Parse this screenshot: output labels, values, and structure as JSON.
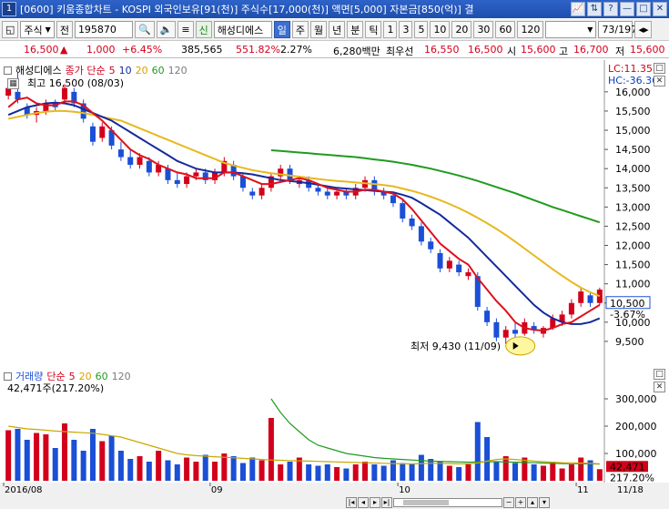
{
  "window": {
    "number": "1",
    "title": "[0600] 키움종합차트 - KOSPI 외국인보유[91(천)] 주식수[17,000(천)] 액면[5,000] 자본금[850(억)] 결",
    "buttons": [
      "📈",
      "⇅",
      "?",
      "—",
      "□",
      "✕"
    ]
  },
  "toolbar": {
    "market": "주식",
    "prev": "전",
    "code": "195870",
    "stock_name": "해성디에스",
    "periods": [
      "일",
      "주",
      "월",
      "년",
      "분",
      "틱"
    ],
    "intervals": [
      "1",
      "3",
      "5",
      "10",
      "20",
      "30",
      "60",
      "120"
    ],
    "paging": "73/197"
  },
  "quote": {
    "price": "16,500",
    "arrow": "▲",
    "change": "1,000",
    "change_pct": "+6.45%",
    "volume": "385,565",
    "vol_ratio": "551.82%",
    "turnover": "2.27%",
    "amount": "6,280백만",
    "best_ask_label": "최우선",
    "best_ask": "16,550",
    "best_bid": "16,500",
    "open_label": "시",
    "open": "15,600",
    "high_label": "고",
    "high": "16,700",
    "low_label": "저",
    "low": "15,600"
  },
  "price_panel": {
    "legend_name": "해성디에스",
    "legend_ma_label": "종가 단순",
    "legend_ma_periods": [
      "5",
      "10",
      "20",
      "60",
      "120"
    ],
    "high_note": "최고 16,500 (08/03)",
    "low_note": "최저 9,430 (11/09)",
    "lc": "LC:11.35",
    "hc": "HC:-36.36",
    "current_price_tag": "10,500",
    "current_pct_tag": "-3.67%"
  },
  "volume_panel": {
    "legend_name": "거래량",
    "legend_ma_label": "단순",
    "legend_ma_periods": [
      "5",
      "20",
      "60",
      "120"
    ],
    "current": "42,471주(217.20%)",
    "current_tag": "42,471",
    "current_pct_tag": "217.20%"
  },
  "colors": {
    "up": "#d2001b",
    "down": "#1a4fd6",
    "ma5": "#e0101c",
    "ma10": "#142a9a",
    "ma20": "#e8b820",
    "ma60": "#1f9b1f",
    "ma120": "#8a8a8a"
  },
  "chart_data": [
    {
      "type": "candlestick",
      "title": "해성디에스",
      "x_ticks": [
        "2016/08",
        "09",
        "10",
        "11",
        "11/18"
      ],
      "ylim": [
        9000,
        16400
      ],
      "yticks": [
        9500,
        10000,
        10500,
        11000,
        11500,
        12000,
        12500,
        13000,
        13500,
        14000,
        14500,
        15000,
        15500,
        16000
      ],
      "series": [
        {
          "name": "ohlc",
          "values": [
            [
              15900,
              16300,
              15800,
              16100
            ],
            [
              16000,
              16500,
              15700,
              15800
            ],
            [
              15600,
              15700,
              15300,
              15400
            ],
            [
              15400,
              15600,
              15200,
              15500
            ],
            [
              15500,
              15800,
              15400,
              15700
            ],
            [
              15700,
              15800,
              15500,
              15600
            ],
            [
              15800,
              16200,
              15700,
              16100
            ],
            [
              16000,
              16100,
              15600,
              15700
            ],
            [
              15700,
              15800,
              15200,
              15300
            ],
            [
              15100,
              15200,
              14600,
              14700
            ],
            [
              14800,
              15200,
              14700,
              15100
            ],
            [
              15000,
              15100,
              14500,
              14600
            ],
            [
              14500,
              14700,
              14200,
              14300
            ],
            [
              14300,
              14500,
              14000,
              14100
            ],
            [
              14100,
              14400,
              14000,
              14300
            ],
            [
              14200,
              14300,
              13800,
              13900
            ],
            [
              13900,
              14200,
              13800,
              14100
            ],
            [
              14000,
              14100,
              13600,
              13700
            ],
            [
              13700,
              13900,
              13500,
              13600
            ],
            [
              13600,
              13900,
              13500,
              13800
            ],
            [
              13800,
              14000,
              13700,
              13900
            ],
            [
              13900,
              14000,
              13600,
              13700
            ],
            [
              13700,
              14000,
              13600,
              13900
            ],
            [
              13900,
              14300,
              13800,
              14200
            ],
            [
              14100,
              14200,
              13700,
              13800
            ],
            [
              13800,
              13900,
              13400,
              13500
            ],
            [
              13400,
              13500,
              13200,
              13300
            ],
            [
              13300,
              13600,
              13200,
              13500
            ],
            [
              13500,
              13900,
              13400,
              13800
            ],
            [
              13800,
              14100,
              13700,
              14000
            ],
            [
              14000,
              14100,
              13600,
              13700
            ],
            [
              13600,
              13800,
              13500,
              13700
            ],
            [
              13700,
              13800,
              13400,
              13500
            ],
            [
              13500,
              13600,
              13300,
              13400
            ],
            [
              13400,
              13500,
              13200,
              13300
            ],
            [
              13300,
              13500,
              13200,
              13400
            ],
            [
              13400,
              13500,
              13200,
              13300
            ],
            [
              13300,
              13600,
              13200,
              13500
            ],
            [
              13500,
              13800,
              13400,
              13700
            ],
            [
              13700,
              13800,
              13300,
              13400
            ],
            [
              13400,
              13500,
              13200,
              13300
            ],
            [
              13300,
              13400,
              13000,
              13100
            ],
            [
              13100,
              13200,
              12600,
              12700
            ],
            [
              12700,
              12800,
              12400,
              12500
            ],
            [
              12500,
              12600,
              12000,
              12100
            ],
            [
              12100,
              12200,
              11800,
              11900
            ],
            [
              11800,
              11900,
              11300,
              11400
            ],
            [
              11400,
              11700,
              11300,
              11600
            ],
            [
              11500,
              11600,
              11200,
              11300
            ],
            [
              11200,
              11400,
              11100,
              11300
            ],
            [
              11200,
              11300,
              10300,
              10400
            ],
            [
              10300,
              10400,
              9900,
              10000
            ],
            [
              10000,
              10100,
              9500,
              9600
            ],
            [
              9600,
              9900,
              9430,
              9800
            ],
            [
              9800,
              10000,
              9600,
              9700
            ],
            [
              9700,
              10100,
              9650,
              10000
            ],
            [
              9900,
              10000,
              9700,
              9800
            ],
            [
              9700,
              9900,
              9600,
              9850
            ],
            [
              9850,
              10200,
              9800,
              10100
            ],
            [
              10000,
              10300,
              9900,
              10200
            ],
            [
              10200,
              10600,
              10100,
              10500
            ],
            [
              10500,
              10900,
              10400,
              10800
            ],
            [
              10700,
              10800,
              10400,
              10500
            ],
            [
              10500,
              10900,
              10450,
              10850
            ]
          ]
        },
        {
          "name": "5",
          "values": [
            15600,
            15800,
            15850,
            15700,
            15650,
            15650,
            15750,
            15750,
            15650,
            15450,
            15250,
            15000,
            14750,
            14500,
            14350,
            14250,
            14100,
            14000,
            13900,
            13850,
            13750,
            13750,
            13750,
            13900,
            13900,
            13800,
            13700,
            13600,
            13600,
            13650,
            13700,
            13750,
            13700,
            13600,
            13500,
            13450,
            13400,
            13400,
            13450,
            13450,
            13400,
            13350,
            13200,
            12950,
            12650,
            12350,
            12050,
            11850,
            11650,
            11500,
            11150,
            10850,
            10550,
            10300,
            10000,
            9850,
            9800,
            9780,
            9850,
            9950,
            10000,
            10150,
            10300,
            10450
          ]
        },
        {
          "name": "10",
          "values": [
            15400,
            15500,
            15600,
            15650,
            15700,
            15720,
            15700,
            15650,
            15550,
            15450,
            15350,
            15250,
            15100,
            14950,
            14800,
            14650,
            14500,
            14350,
            14200,
            14100,
            14000,
            13950,
            13900,
            13900,
            13900,
            13880,
            13850,
            13800,
            13750,
            13700,
            13680,
            13650,
            13620,
            13580,
            13540,
            13500,
            13480,
            13460,
            13440,
            13420,
            13400,
            13380,
            13320,
            13240,
            13100,
            12950,
            12800,
            12600,
            12400,
            12200,
            11950,
            11700,
            11450,
            11200,
            10950,
            10700,
            10450,
            10250,
            10100,
            10000,
            9950,
            9950,
            10000,
            10100
          ]
        },
        {
          "name": "20",
          "values": [
            15300,
            15350,
            15400,
            15450,
            15480,
            15500,
            15500,
            15480,
            15450,
            15400,
            15350,
            15300,
            15250,
            15150,
            15050,
            14950,
            14850,
            14750,
            14650,
            14550,
            14450,
            14350,
            14250,
            14150,
            14080,
            14020,
            13960,
            13920,
            13880,
            13850,
            13820,
            13790,
            13760,
            13730,
            13700,
            13680,
            13660,
            13640,
            13620,
            13600,
            13570,
            13540,
            13480,
            13420,
            13350,
            13270,
            13180,
            13080,
            12970,
            12850,
            12720,
            12580,
            12430,
            12270,
            12100,
            11920,
            11740,
            11560,
            11380,
            11210,
            11050,
            10900,
            10780,
            10680
          ]
        },
        {
          "name": "60",
          "values": [
            null,
            null,
            null,
            null,
            null,
            null,
            null,
            null,
            null,
            null,
            null,
            null,
            null,
            null,
            null,
            null,
            null,
            null,
            null,
            null,
            null,
            null,
            null,
            null,
            null,
            null,
            null,
            null,
            14480,
            14460,
            14440,
            14420,
            14400,
            14380,
            14360,
            14340,
            14320,
            14300,
            14270,
            14240,
            14210,
            14180,
            14140,
            14100,
            14050,
            14000,
            13940,
            13880,
            13820,
            13750,
            13680,
            13600,
            13520,
            13440,
            13360,
            13270,
            13180,
            13090,
            13000,
            12920,
            12840,
            12760,
            12680,
            12600
          ]
        }
      ]
    },
    {
      "type": "bar",
      "title": "거래량",
      "ylim": [
        0,
        360000
      ],
      "yticks": [
        100000,
        200000,
        300000
      ],
      "series": [
        {
          "name": "volume",
          "values": [
            185000,
            190000,
            150000,
            175000,
            170000,
            120000,
            210000,
            150000,
            110000,
            190000,
            145000,
            165000,
            110000,
            80000,
            90000,
            70000,
            110000,
            75000,
            60000,
            85000,
            70000,
            95000,
            70000,
            100000,
            90000,
            65000,
            85000,
            75000,
            230000,
            60000,
            70000,
            85000,
            60000,
            55000,
            60000,
            50000,
            45000,
            60000,
            70000,
            60000,
            55000,
            75000,
            65000,
            60000,
            95000,
            80000,
            70000,
            55000,
            50000,
            60000,
            215000,
            160000,
            70000,
            90000,
            65000,
            85000,
            60000,
            55000,
            70000,
            45000,
            60000,
            85000,
            75000,
            42471
          ]
        },
        {
          "name": "5",
          "values": [
            200000,
            195000,
            190000,
            188000,
            185000,
            182000,
            180000,
            178000,
            176000,
            174000,
            170000,
            165000,
            160000,
            150000,
            140000,
            130000,
            120000,
            110000,
            100000,
            95000,
            92000,
            90000,
            88000,
            86000,
            84000,
            82000,
            80000,
            78000,
            76000,
            75000,
            74000,
            73000,
            72000,
            71000,
            70000,
            69000,
            68000,
            67000,
            66000,
            65000,
            64000,
            63000,
            62000,
            62000,
            63000,
            64000,
            64000,
            63000,
            62000,
            62000,
            65000,
            72000,
            78000,
            80000,
            78000,
            75000,
            72000,
            70000,
            68000,
            66000,
            65000,
            65000,
            64000,
            62000
          ]
        },
        {
          "name": "20",
          "values": [
            null,
            null,
            null,
            null,
            null,
            null,
            null,
            null,
            null,
            null,
            null,
            null,
            null,
            null,
            null,
            null,
            null,
            null,
            null,
            null,
            null,
            null,
            null,
            null,
            null,
            null,
            null,
            null,
            300000,
            250000,
            210000,
            180000,
            150000,
            130000,
            120000,
            110000,
            100000,
            95000,
            90000,
            85000,
            82000,
            80000,
            78000,
            76000,
            74000,
            72000,
            71000,
            70000,
            69000,
            68000,
            69000,
            70000,
            70000,
            69000,
            68000,
            67000,
            66000,
            65000,
            64000,
            63000,
            63000,
            62000,
            62000,
            61000
          ]
        }
      ]
    }
  ]
}
